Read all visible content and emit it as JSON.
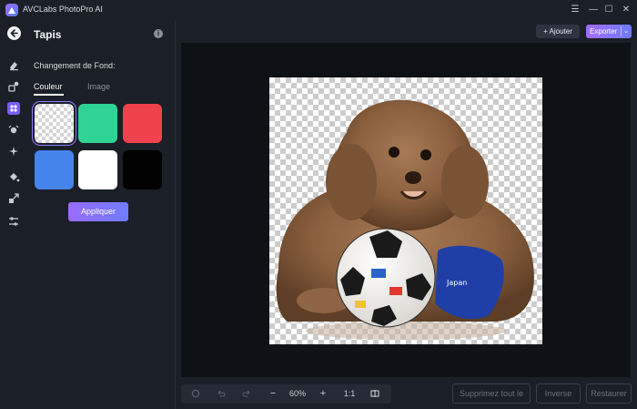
{
  "app": {
    "title": "AVCLabs PhotoPro AI"
  },
  "window_controls": {
    "menu": "☰",
    "minimize": "—",
    "maximize": "☐",
    "close": "✕"
  },
  "rail": {
    "items": [
      "back-icon",
      "eraser-icon",
      "retouch-icon",
      "background-icon",
      "face-icon",
      "sparkle-icon",
      "fill-icon",
      "upscale-icon",
      "adjust-icon"
    ],
    "active": "background-icon"
  },
  "panel": {
    "title": "Tapis",
    "info_icon": "i",
    "section_label": "Changement de Fond:",
    "tabs": [
      {
        "label": "Couleur",
        "active": true
      },
      {
        "label": "Image",
        "active": false
      }
    ],
    "swatches": [
      {
        "name": "transparent",
        "color": "transparent",
        "selected": true
      },
      {
        "name": "green",
        "color": "#2fd394",
        "selected": false
      },
      {
        "name": "red",
        "color": "#f0424d",
        "selected": false
      },
      {
        "name": "blue",
        "color": "#4584ea",
        "selected": false
      },
      {
        "name": "white",
        "color": "#ffffff",
        "selected": false
      },
      {
        "name": "black",
        "color": "#000000",
        "selected": false
      }
    ],
    "apply_label": "Appliquer"
  },
  "toolbar": {
    "add_label": "+ Ajouter",
    "export_label": "Exporter",
    "export_chevron": "⌄"
  },
  "bottom": {
    "zoom": "60%",
    "zoom_out": "−",
    "zoom_in": "+",
    "actual_size": "1:1",
    "remove_mask_label": "Supprimez tout le masque",
    "invert_label": "Inverse",
    "restore_label": "Restaurer"
  },
  "colors": {
    "accent": "#7a5cff",
    "background": "#1b1f27",
    "canvas": "#0e1116"
  }
}
